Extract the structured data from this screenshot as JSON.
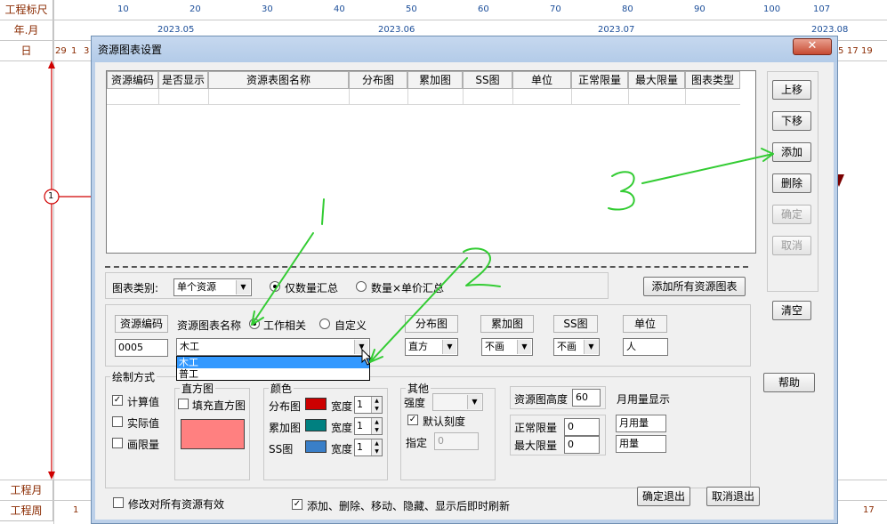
{
  "schedule": {
    "row_labels": {
      "ruler": "工程标尺",
      "year_month": "年.月",
      "day": "日",
      "project_month": "工程月",
      "project_week": "工程周"
    },
    "ruler_ticks": [
      "10",
      "20",
      "30",
      "40",
      "50",
      "60",
      "70",
      "80",
      "90",
      "100",
      "107"
    ],
    "months": [
      "2023.05",
      "2023.06",
      "2023.07",
      "2023.08"
    ],
    "day_left": [
      "29",
      "1",
      "3"
    ],
    "day_right": [
      "5",
      "17",
      "19"
    ],
    "week_left": "1",
    "week_right": "17",
    "node_label": "1"
  },
  "dialog": {
    "title": "资源图表设置",
    "close_label": "✕",
    "table_headers": [
      "资源编码",
      "是否显示",
      "资源表图名称",
      "分布图",
      "累加图",
      "SS图",
      "单位",
      "正常限量",
      "最大限量",
      "图表类型"
    ],
    "side_buttons": {
      "up": "上移",
      "down": "下移",
      "add": "添加",
      "delete": "删除",
      "confirm": "确定",
      "cancel": "取消",
      "clear": "清空",
      "help": "帮助"
    },
    "chart_category": {
      "label": "图表类别:",
      "value": "单个资源",
      "option_quantity": "仅数量汇总",
      "option_price": "数量×单价汇总",
      "add_all": "添加所有资源图表"
    },
    "resource": {
      "code_label": "资源编码",
      "name_label": "资源图表名称",
      "work_related": "工作相关",
      "custom": "自定义",
      "code_value": "0005",
      "name_value": "木工",
      "dropdown_options": [
        "木工",
        "普工"
      ],
      "dist_label": "分布图",
      "dist_value": "直方",
      "accum_label": "累加图",
      "accum_value": "不画",
      "ss_label": "SS图",
      "ss_value": "不画",
      "unit_label": "单位",
      "unit_value": "人"
    },
    "draw_mode": {
      "label": "绘制方式",
      "calc_value": "计算值",
      "actual_value": "实际值",
      "draw_limit": "画限量",
      "histogram_group": "直方图",
      "fill_histogram": "填充直方图",
      "histogram_color": "#ff8080",
      "colors_group": "颜色",
      "dist_chart": "分布图",
      "accum_chart": "累加图",
      "ss_chart": "SS图",
      "width_label": "宽度",
      "dist_color": "#cc0000",
      "accum_color": "#008080",
      "ss_color": "#3a7fc8",
      "dist_width": "1",
      "accum_width": "1",
      "ss_width": "1",
      "other_group": "其他",
      "intensity_label": "强度",
      "default_scale": "默认刻度",
      "specify_label": "指定",
      "specify_value": "0",
      "height_label": "资源图高度",
      "height_value": "60",
      "normal_limit_label": "正常限量",
      "normal_limit_value": "0",
      "max_limit_label": "最大限量",
      "max_limit_value": "0",
      "monthly_display_label": "月用量显示",
      "monthly_value": "月用量",
      "usage_value": "用量"
    },
    "bottom": {
      "apply_all": "修改对所有资源有效",
      "refresh": "添加、删除、移动、隐藏、显示后即时刷新",
      "ok_exit": "确定退出",
      "cancel_exit": "取消退出"
    }
  },
  "annotations": {
    "mark_1": "1",
    "mark_2": "2",
    "mark_3": "3",
    "color": "#33cc33"
  }
}
